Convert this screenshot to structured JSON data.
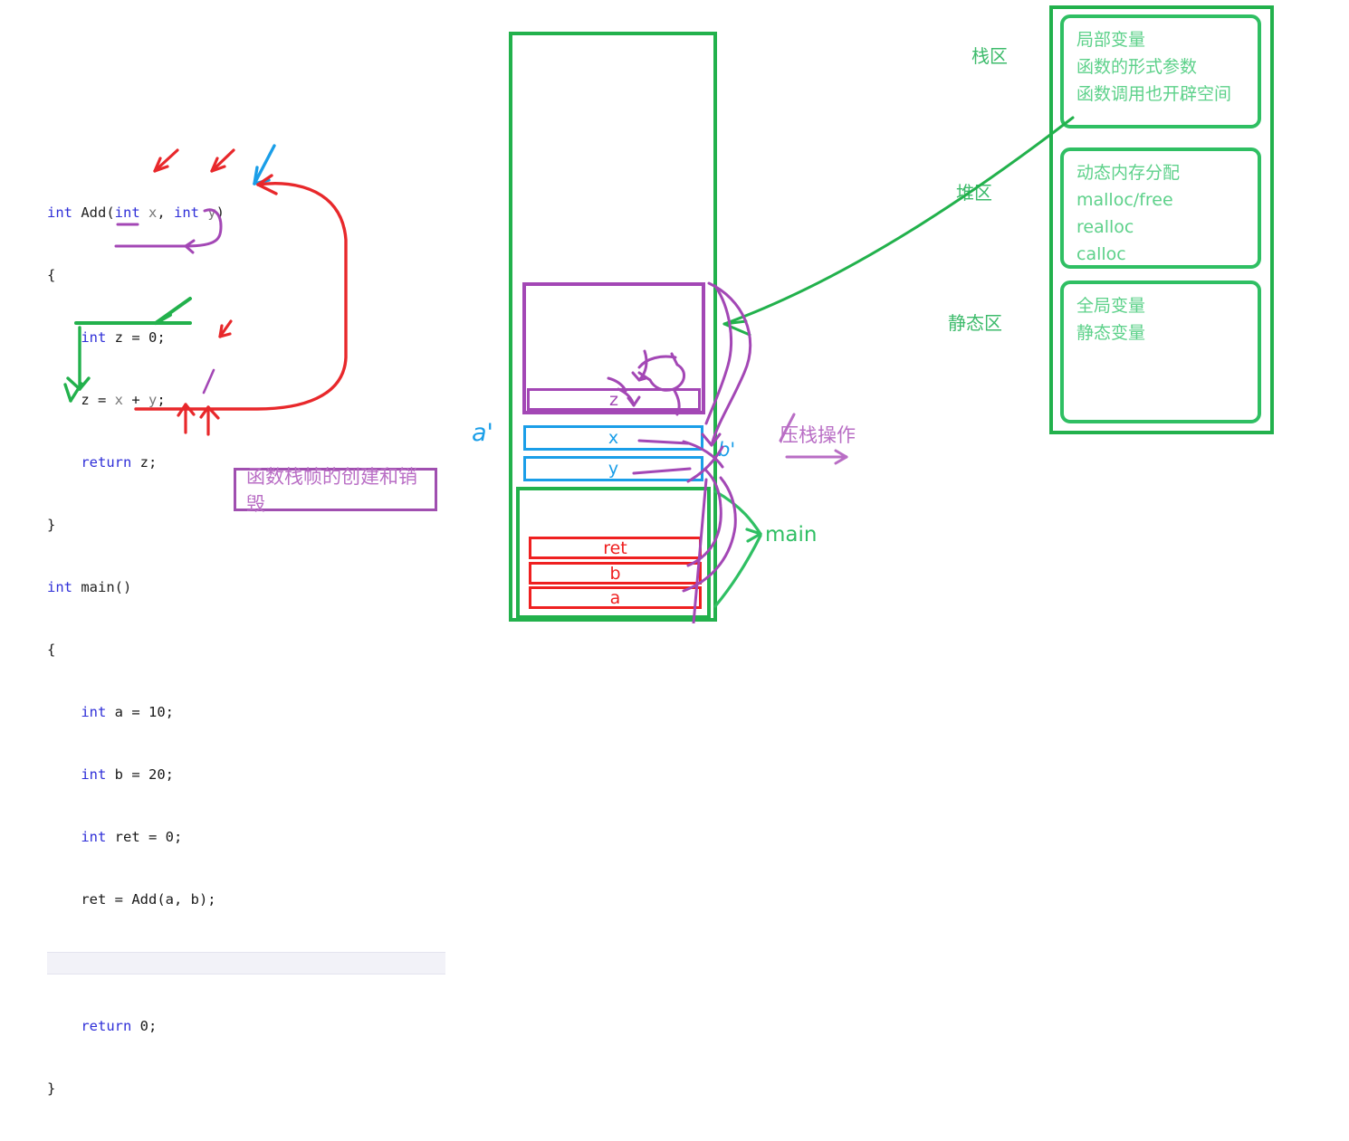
{
  "code": {
    "language": "c",
    "lines": [
      [
        {
          "t": "int ",
          "c": "kw"
        },
        {
          "t": "Add(",
          "c": "fn"
        },
        {
          "t": "int ",
          "c": "kw"
        },
        {
          "t": "x",
          "c": "var"
        },
        {
          "t": ", ",
          "c": "fn"
        },
        {
          "t": "int ",
          "c": "kw"
        },
        {
          "t": "y",
          "c": "var"
        },
        {
          "t": ")",
          "c": "fn"
        }
      ],
      [
        {
          "t": "{",
          "c": "pl"
        }
      ],
      [
        {
          "t": "    ",
          "c": "pl"
        },
        {
          "t": "int ",
          "c": "kw"
        },
        {
          "t": "z = 0;",
          "c": "pl"
        }
      ],
      [
        {
          "t": "    z = ",
          "c": "pl"
        },
        {
          "t": "x",
          "c": "var"
        },
        {
          "t": " + ",
          "c": "pl"
        },
        {
          "t": "y",
          "c": "var"
        },
        {
          "t": ";",
          "c": "pl"
        }
      ],
      [
        {
          "t": "    ",
          "c": "pl"
        },
        {
          "t": "return ",
          "c": "kw"
        },
        {
          "t": "z;",
          "c": "pl"
        }
      ],
      [
        {
          "t": "}",
          "c": "pl"
        }
      ],
      [
        {
          "t": "int ",
          "c": "kw"
        },
        {
          "t": "main()",
          "c": "fn"
        }
      ],
      [
        {
          "t": "{",
          "c": "pl"
        }
      ],
      [
        {
          "t": "    ",
          "c": "pl"
        },
        {
          "t": "int ",
          "c": "kw"
        },
        {
          "t": "a = 10;",
          "c": "pl"
        }
      ],
      [
        {
          "t": "    ",
          "c": "pl"
        },
        {
          "t": "int ",
          "c": "kw"
        },
        {
          "t": "b = 20;",
          "c": "pl"
        }
      ],
      [
        {
          "t": "    ",
          "c": "pl"
        },
        {
          "t": "int ",
          "c": "kw"
        },
        {
          "t": "ret = 0;",
          "c": "pl"
        }
      ],
      [
        {
          "t": "    ret = Add(a, b);",
          "c": "pl"
        }
      ],
      [
        {
          "t": "",
          "c": "pl"
        }
      ],
      [
        {
          "t": "    ",
          "c": "pl"
        },
        {
          "t": "return ",
          "c": "kw"
        },
        {
          "t": "0;",
          "c": "pl"
        }
      ],
      [
        {
          "t": "}",
          "c": "pl"
        }
      ]
    ],
    "highlighted_line_index": 12
  },
  "caption": {
    "text": "函数栈帧的创建和销毁",
    "border_color": "#a04fb0",
    "text_color": "#b96ec5"
  },
  "stack_diagram": {
    "frame_add_label": "",
    "slots": {
      "z": "z",
      "x": "x",
      "y": "y",
      "ret": "ret",
      "b": "b",
      "a": "a"
    },
    "annotations": {
      "a_prime": "a'",
      "b_prime": "b'",
      "main": "main",
      "push_operation": "压栈操作"
    },
    "colors": {
      "green": "#22b14c",
      "purple": "#a347b5",
      "blue": "#1a9ee8",
      "red": "#ef2020"
    }
  },
  "memory_zones": {
    "labels": [
      {
        "name": "stack",
        "text": "栈区"
      },
      {
        "name": "heap",
        "text": "堆区"
      },
      {
        "name": "static",
        "text": "静态区"
      }
    ],
    "boxes": [
      {
        "name": "stack-zone-box",
        "lines": [
          "局部变量",
          "函数的形式参数",
          "函数调用也开辟空间"
        ]
      },
      {
        "name": "heap-zone-box",
        "lines": [
          "动态内存分配",
          "malloc/free",
          "realloc",
          "calloc"
        ]
      },
      {
        "name": "static-zone-box",
        "lines": [
          "全局变量",
          "静态变量"
        ]
      }
    ],
    "color": "#2fbf63",
    "text_color": "#5dd18a"
  }
}
